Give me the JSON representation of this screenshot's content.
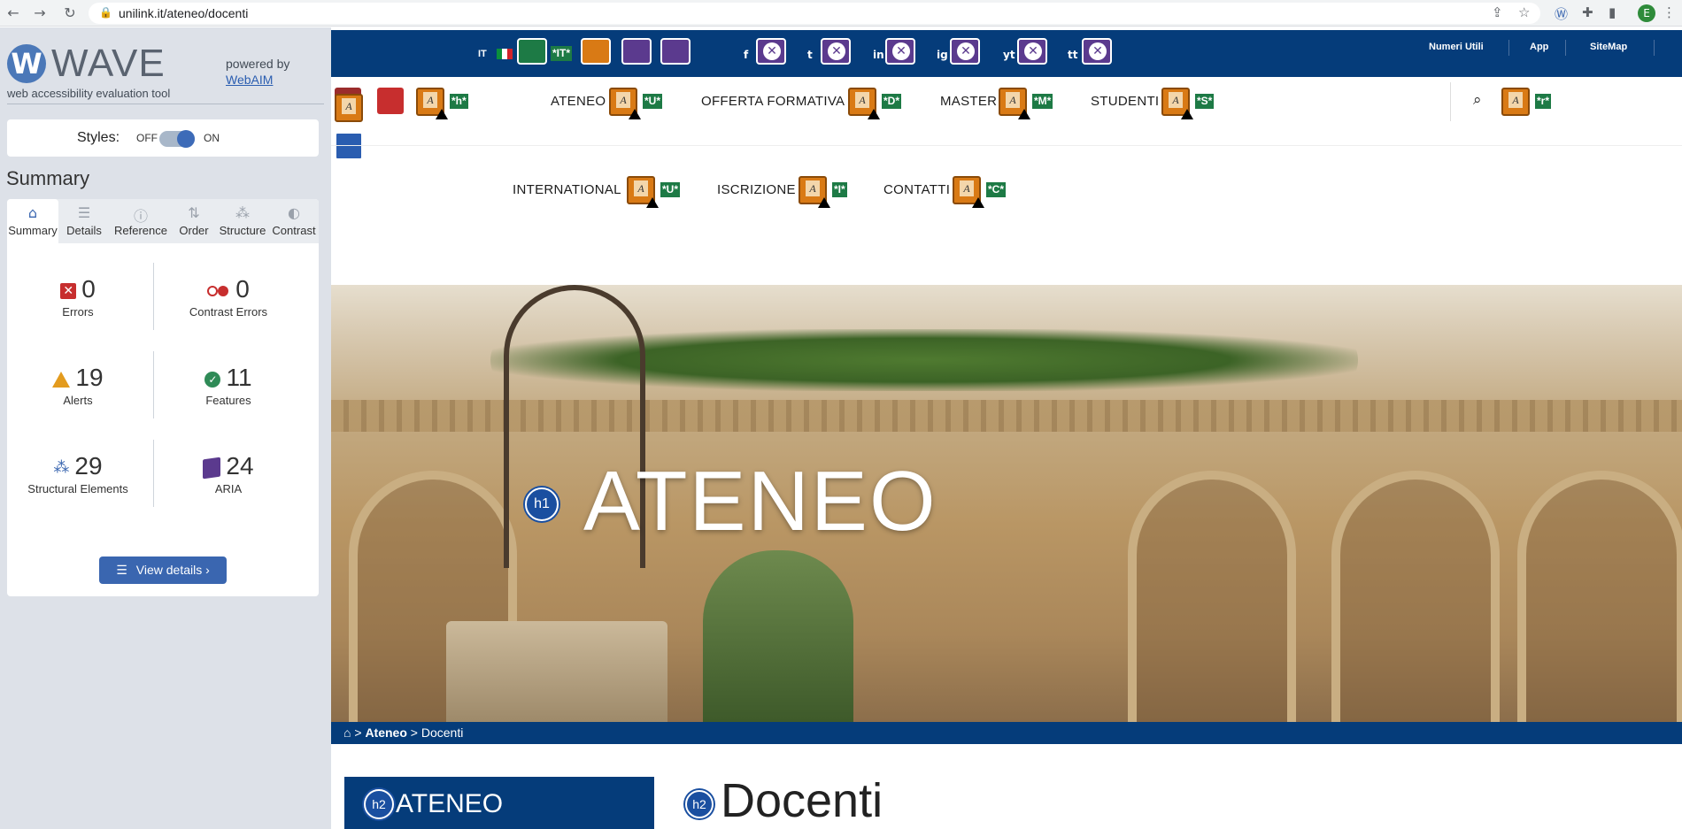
{
  "browser": {
    "url": "unilink.it/ateneo/docenti",
    "avatar_letter": "E"
  },
  "wave": {
    "logo_letter": "W",
    "logo_text": "WAVE",
    "tagline": "web accessibility evaluation tool",
    "powered_by": "powered by",
    "webaim_link": "WebAIM",
    "styles": {
      "label": "Styles:",
      "off": "OFF",
      "on": "ON"
    },
    "summary_heading": "Summary",
    "tabs": [
      {
        "label": "Summary",
        "icon": "home-icon",
        "active": true
      },
      {
        "label": "Details",
        "icon": "list-icon"
      },
      {
        "label": "Reference",
        "icon": "info-icon"
      },
      {
        "label": "Order",
        "icon": "order-icon"
      },
      {
        "label": "Structure",
        "icon": "structure-icon"
      },
      {
        "label": "Contrast",
        "icon": "contrast-icon"
      }
    ],
    "stats": {
      "errors": {
        "value": "0",
        "label": "Errors"
      },
      "contrast_errors": {
        "value": "0",
        "label": "Contrast Errors"
      },
      "alerts": {
        "value": "19",
        "label": "Alerts"
      },
      "features": {
        "value": "11",
        "label": "Features"
      },
      "structural": {
        "value": "29",
        "label": "Structural Elements"
      },
      "aria": {
        "value": "24",
        "label": "ARIA"
      }
    },
    "view_details": "View details ›",
    "colors": {
      "error": "#c72e2e",
      "alert": "#e39b1e",
      "feature": "#2f8b57",
      "aria": "#5b3a8e",
      "accent": "#3a66b0"
    }
  },
  "site": {
    "topbar": {
      "lang": "IT",
      "lang_tag": "*IT*",
      "numeri_utili": "Numeri Utili",
      "app": "App",
      "sitemap": "SiteMap",
      "social": [
        "f",
        "t",
        "in",
        "ig",
        "yt",
        "tt"
      ]
    },
    "nav_row1": [
      {
        "label": "ATENEO",
        "tag": "*U*"
      },
      {
        "label": "OFFERTA FORMATIVA",
        "tag": "*D*"
      },
      {
        "label": "MASTER",
        "tag": "*M*"
      },
      {
        "label": "STUDENTI",
        "tag": "*S*"
      }
    ],
    "nav_row2": [
      {
        "label": "INTERNATIONAL",
        "tag": "*U*"
      },
      {
        "label": "ISCRIZIONE",
        "tag": "*I*"
      },
      {
        "label": "CONTATTI",
        "tag": "*C*"
      }
    ],
    "logo_tag": "*h*",
    "search_tag": "*r*",
    "hero_title": "ATENEO",
    "breadcrumb": {
      "level1": "Ateneo",
      "level2": "Docenti"
    },
    "side_heading": "ATENEO",
    "main_heading": "Docenti",
    "h1_badge": "h1",
    "h2_badge": "h2",
    "colors": {
      "brand": "#053c7a"
    }
  }
}
